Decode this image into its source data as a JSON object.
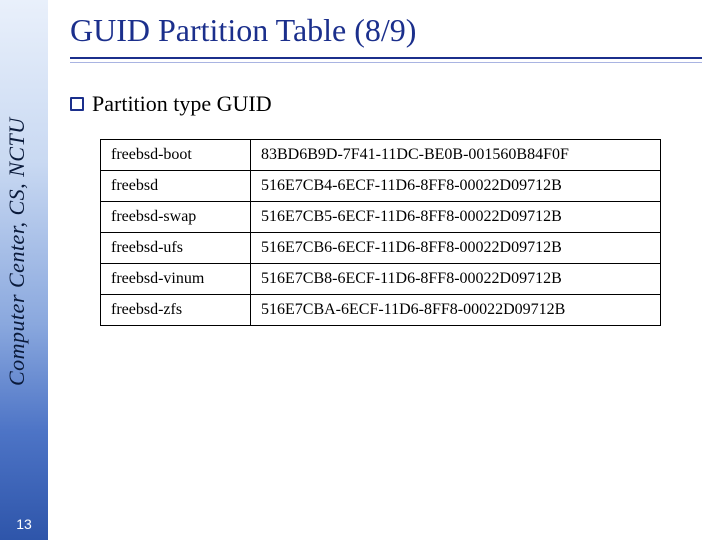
{
  "sidebar": {
    "org_text": "Computer Center, CS, NCTU",
    "page_number": "13"
  },
  "title": "GUID Partition Table (8/9)",
  "bullet": {
    "text": "Partition type GUID"
  },
  "table": {
    "rows": [
      {
        "name": "freebsd-boot",
        "guid": "83BD6B9D-7F41-11DC-BE0B-001560B84F0F"
      },
      {
        "name": "freebsd",
        "guid": "516E7CB4-6ECF-11D6-8FF8-00022D09712B"
      },
      {
        "name": "freebsd-swap",
        "guid": "516E7CB5-6ECF-11D6-8FF8-00022D09712B"
      },
      {
        "name": "freebsd-ufs",
        "guid": "516E7CB6-6ECF-11D6-8FF8-00022D09712B"
      },
      {
        "name": "freebsd-vinum",
        "guid": "516E7CB8-6ECF-11D6-8FF8-00022D09712B"
      },
      {
        "name": "freebsd-zfs",
        "guid": "516E7CBA-6ECF-11D6-8FF8-00022D09712B"
      }
    ]
  }
}
